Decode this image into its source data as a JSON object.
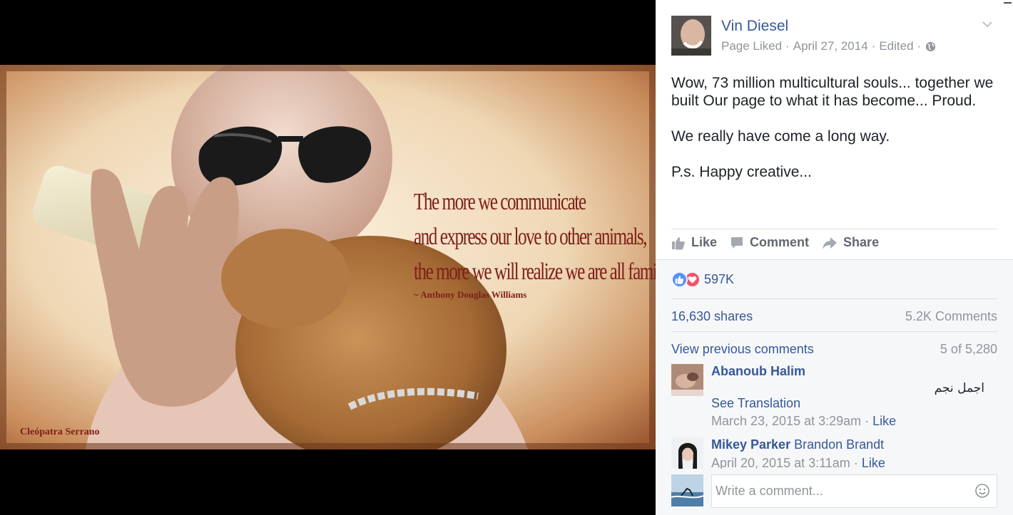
{
  "photo": {
    "quote_lines": [
      "The more we communicate",
      "and express our love to other animals,",
      "the more we will realize we are all family."
    ],
    "quote_author": "~ Anthony Douglas Williams",
    "credit": "Cleópatra Serrano"
  },
  "post": {
    "author": "Vin Diesel",
    "meta": {
      "status": "Page Liked",
      "date": "April 27, 2014",
      "edited": "Edited",
      "privacy_icon": "globe-icon"
    },
    "body": [
      "Wow, 73 million multicultural souls... together we built Our page to what it has become... Proud.",
      "We really have come a long way.",
      "P.s. Happy creative..."
    ]
  },
  "actions": {
    "like": "Like",
    "comment": "Comment",
    "share": "Share"
  },
  "stats": {
    "reactions_count": "597K",
    "reaction_types": [
      "like",
      "love"
    ],
    "shares": "16,630 shares",
    "comments": "5.2K Comments"
  },
  "comments_section": {
    "view_previous": "View previous comments",
    "count": "5 of 5,280",
    "items": [
      {
        "author": "Abanoub Halim",
        "text": "اجمل نجم",
        "see_translation": "See Translation",
        "timestamp": "March 23, 2015 at 3:29am",
        "like": "Like"
      },
      {
        "author": "Mikey Parker",
        "tag": "Brandon Brandt",
        "timestamp": "April 20, 2015 at 3:11am",
        "like": "Like"
      }
    ],
    "composer_placeholder": "Write a comment..."
  },
  "colors": {
    "link": "#365899",
    "meta": "#90949c",
    "quote": "#7e1f1a",
    "like_blue": "#5890ff",
    "love_red": "#f25268"
  }
}
